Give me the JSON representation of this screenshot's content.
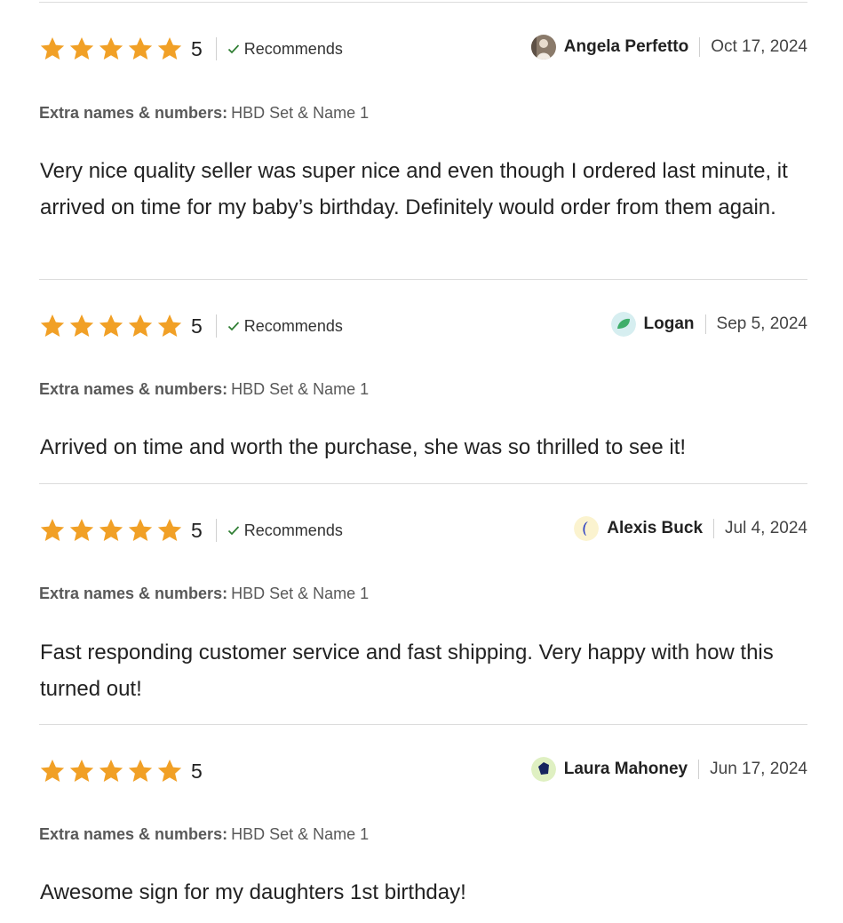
{
  "star_color": "#f1a026",
  "check_color": "#2e7d32",
  "reviews": [
    {
      "rating": "5",
      "recommends": "Recommends",
      "avatar_icon": "photo-avatar-icon",
      "reviewer": "Angela Perfetto",
      "date": "Oct 17, 2024",
      "extra_label": "Extra names & numbers:",
      "extra_value": "HBD Set & Name 1",
      "text": "Very nice quality seller was super nice and even though I ordered last minute, it arrived on time for my baby’s birthday. Definitely would order from them again."
    },
    {
      "rating": "5",
      "recommends": "Recommends",
      "avatar_icon": "green-leaf-avatar-icon",
      "reviewer": "Logan",
      "date": "Sep 5, 2024",
      "extra_label": "Extra names & numbers:",
      "extra_value": "HBD Set & Name 1",
      "text": "Arrived on time and worth the purchase, she was so thrilled to see it!"
    },
    {
      "rating": "5",
      "recommends": "Recommends",
      "avatar_icon": "blue-crescent-avatar-icon",
      "reviewer": "Alexis Buck",
      "date": "Jul 4, 2024",
      "extra_label": "Extra names & numbers:",
      "extra_value": "HBD Set & Name 1",
      "text": "Fast responding customer service and fast shipping. Very happy with how this turned out!"
    },
    {
      "rating": "5",
      "reviewer": "Laura Mahoney",
      "avatar_icon": "navy-pentagon-avatar-icon",
      "date": "Jun 17, 2024",
      "extra_label": "Extra names & numbers:",
      "extra_value": "HBD Set & Name 1",
      "text": "Awesome sign for my daughters 1st birthday!"
    }
  ]
}
